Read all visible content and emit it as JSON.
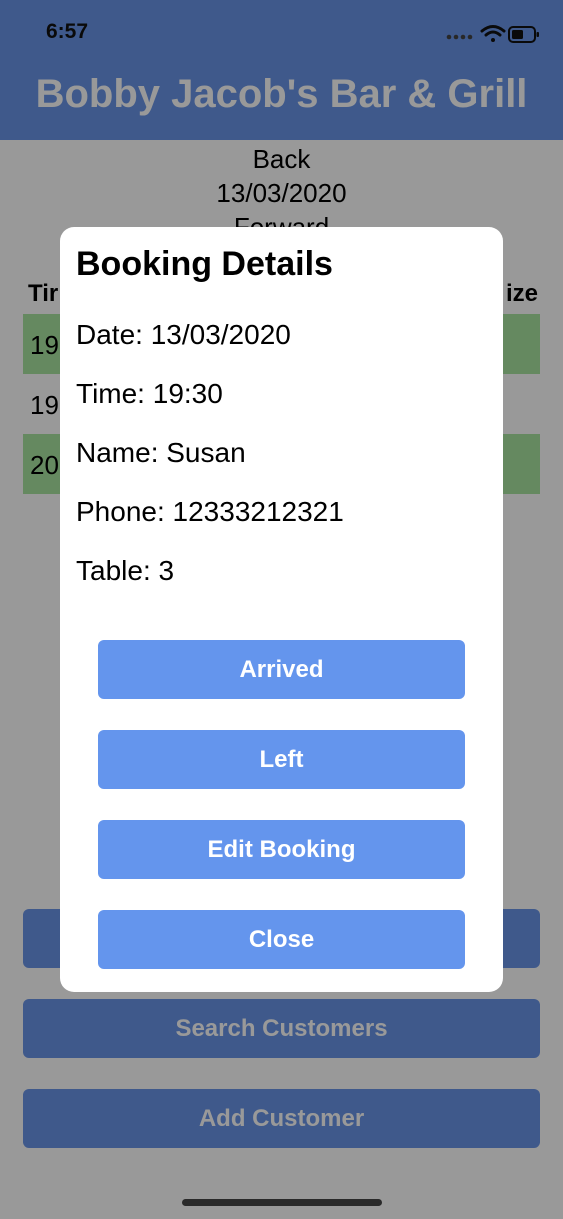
{
  "status_bar": {
    "time": "6:57",
    "icons": [
      "signal-icon",
      "wifi-icon",
      "battery-icon"
    ]
  },
  "header": {
    "title": "Bobby Jacob's Bar & Grill",
    "color": "#6a95e8"
  },
  "date_nav": {
    "back": "Back",
    "date": "13/03/2020",
    "forward": "Forward"
  },
  "table": {
    "headers": {
      "time": "Tir",
      "size": "ize"
    },
    "rows": [
      {
        "time": "19",
        "highlight": true
      },
      {
        "time": "19",
        "highlight": false
      },
      {
        "time": "20",
        "highlight": true
      }
    ]
  },
  "main_buttons": {
    "hidden": "",
    "search": "Search Customers",
    "add": "Add Customer"
  },
  "modal": {
    "title": "Booking Details",
    "date": "Date: 13/03/2020",
    "time": "Time: 19:30",
    "name": "Name: Susan",
    "phone": "Phone: 12333212321",
    "table": "Table: 3",
    "buttons": {
      "arrived": "Arrived",
      "left": "Left",
      "edit": "Edit Booking",
      "close": "Close"
    }
  },
  "colors": {
    "accent": "#6495ed",
    "row_highlight": "#a8e5a0"
  }
}
